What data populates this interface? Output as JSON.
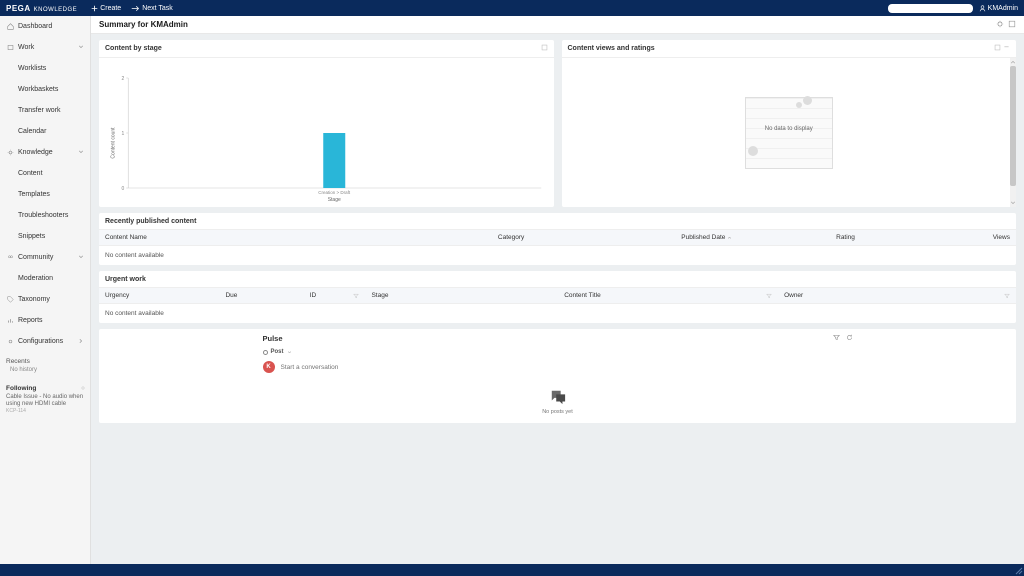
{
  "header": {
    "logo_main": "PEGA",
    "logo_sub": "KNOWLEDGE",
    "create": "Create",
    "next_task": "Next Task",
    "user": "KMAdmin"
  },
  "nav": {
    "dashboard": "Dashboard",
    "work": "Work",
    "worklists": "Worklists",
    "workbaskets": "Workbaskets",
    "transfer_work": "Transfer work",
    "calendar": "Calendar",
    "knowledge": "Knowledge",
    "content": "Content",
    "templates": "Templates",
    "troubleshooters": "Troubleshooters",
    "snippets": "Snippets",
    "community": "Community",
    "moderation": "Moderation",
    "taxonomy": "Taxonomy",
    "reports": "Reports",
    "configurations": "Configurations",
    "recents": "Recents",
    "no_history": "No history",
    "following": "Following",
    "following_item": "Cable Issue - No audio when using new HDMI cable",
    "following_item_sub": "KCP-114"
  },
  "page": {
    "title": "Summary for  KMAdmin"
  },
  "cards": {
    "by_stage_title": "Content by stage",
    "views_title": "Content views and ratings",
    "no_data": "No data to display"
  },
  "chart_data": {
    "type": "bar",
    "title": "Content by stage",
    "xlabel": "Stage",
    "ylabel": "Content count",
    "categories": [
      "Creation > Draft"
    ],
    "values": [
      1
    ],
    "ylim": [
      0,
      2
    ]
  },
  "tables": {
    "recent_title": "Recently published content",
    "recent_cols": [
      "Content Name",
      "Category",
      "Published Date",
      "Rating",
      "Views"
    ],
    "urgent_title": "Urgent work",
    "urgent_cols": [
      "Urgency",
      "Due",
      "ID",
      "Stage",
      "Content Title",
      "Owner"
    ],
    "no_content": "No content available"
  },
  "pulse": {
    "title": "Pulse",
    "tab_post": "Post",
    "placeholder": "Start a conversation",
    "avatar_initial": "K",
    "no_posts": "No posts yet"
  }
}
